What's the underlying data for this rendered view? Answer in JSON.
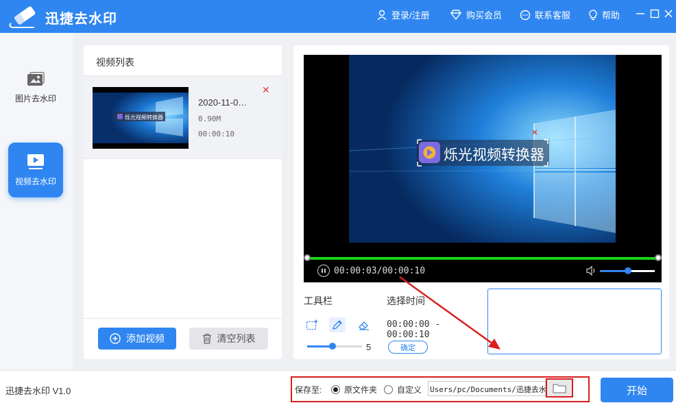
{
  "app": {
    "title": "迅捷去水印",
    "version": "迅捷去水印 V1.0"
  },
  "titlebar": {
    "login": "登录/注册",
    "buy": "购买会员",
    "support": "联系客服",
    "help": "帮助"
  },
  "sidebar": {
    "items": [
      {
        "label": "图片去水印",
        "icon": "image-icon",
        "active": false
      },
      {
        "label": "视频去水印",
        "icon": "video-play-icon",
        "active": true
      }
    ]
  },
  "list": {
    "header": "视频列表",
    "items": [
      {
        "name": "2020-11-0…",
        "size": "0.90M",
        "duration": "00:00:10",
        "thumb_text": "烁光视频转换器"
      }
    ],
    "add_label": "添加视频",
    "clear_label": "清空列表"
  },
  "player": {
    "watermark_text": "烁光视频转换器",
    "time": "00:00:03/00:00:10",
    "progress": 1.0,
    "volume": 0.5
  },
  "tools": {
    "label": "工具栏",
    "select_time_label": "选择时间",
    "brush_size": "5",
    "range": "00:00:00 - 00:00:10",
    "confirm_label": "确定"
  },
  "bottom": {
    "save_label": "保存至:",
    "option_original": "原文件夹",
    "option_custom": "自定义",
    "path": "Users/pc/Documents/迅捷去水印",
    "start_label": "开始"
  },
  "colors": {
    "accent": "#2f86f0",
    "annotation": "#d91e1e",
    "progress": "#18d418"
  }
}
